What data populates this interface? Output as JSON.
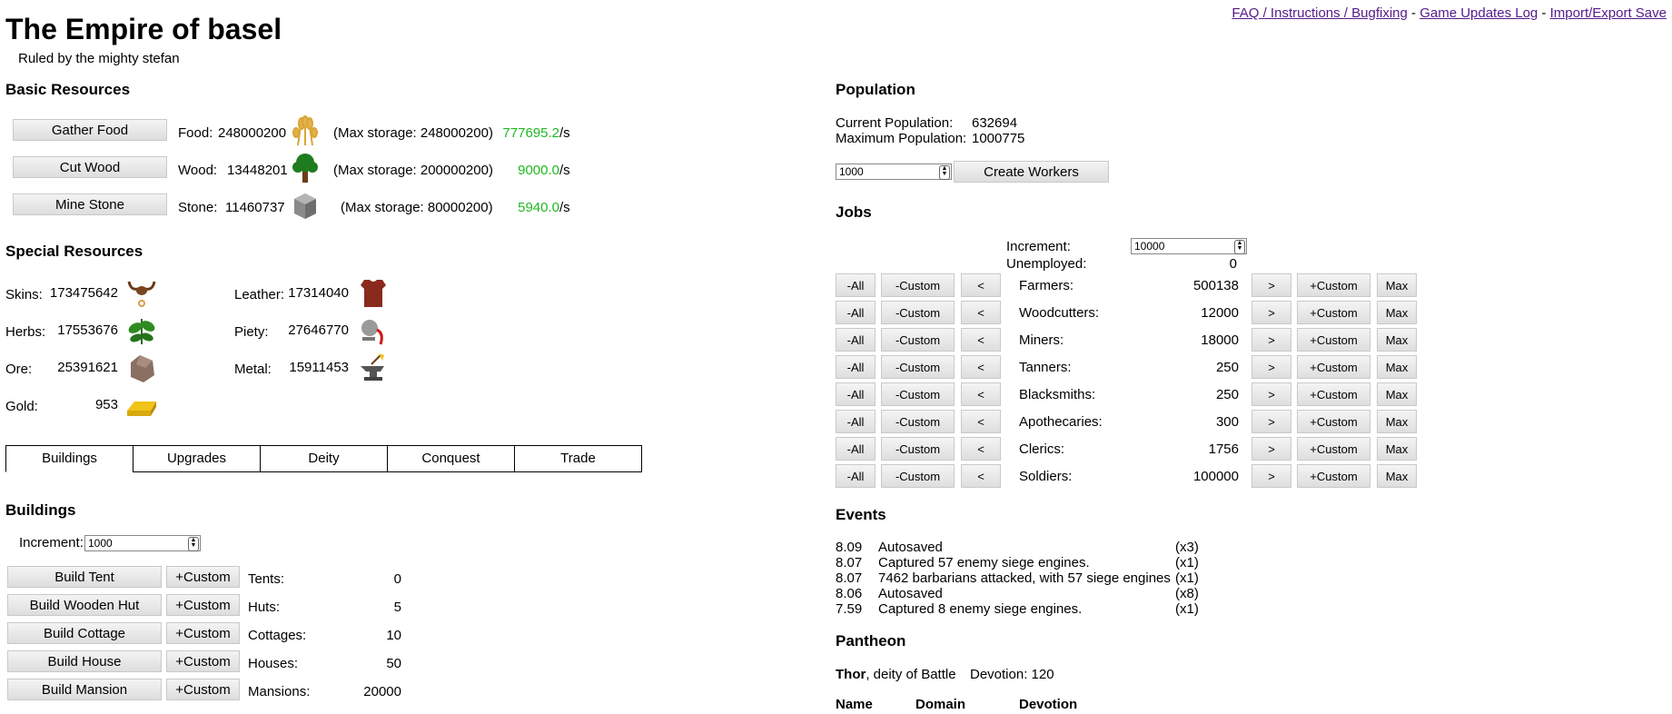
{
  "header": {
    "title": "The Empire of basel",
    "subtitle": "Ruled by the mighty stefan",
    "links": [
      "FAQ / Instructions / Bugfixing",
      "Game Updates Log",
      "Import/Export Save"
    ],
    "separator": " - "
  },
  "basic": {
    "heading": "Basic Resources",
    "rows": [
      {
        "button": "Gather Food",
        "label": "Food:",
        "amount": "248000200",
        "storage": "(Max storage: 248000200)",
        "rate": "777695.2",
        "unit": "/s",
        "icon": "wheat-icon"
      },
      {
        "button": "Cut Wood",
        "label": "Wood:",
        "amount": "13448201",
        "storage": "(Max storage: 200000200)",
        "rate": "9000.0",
        "unit": "/s",
        "icon": "tree-icon"
      },
      {
        "button": "Mine Stone",
        "label": "Stone:",
        "amount": "11460737",
        "storage": "(Max storage: 80000200)",
        "rate": "5940.0",
        "unit": "/s",
        "icon": "stone-icon"
      }
    ]
  },
  "special": {
    "heading": "Special Resources",
    "left": [
      {
        "label": "Skins:",
        "amount": "173475642",
        "icon": "skull-horns-icon"
      },
      {
        "label": "Herbs:",
        "amount": "17553676",
        "icon": "herb-icon"
      },
      {
        "label": "Ore:",
        "amount": "25391621",
        "icon": "ore-icon"
      },
      {
        "label": "Gold:",
        "amount": "953",
        "icon": "gold-bar-icon"
      }
    ],
    "right": [
      {
        "label": "Leather:",
        "amount": "17314040",
        "icon": "leather-armor-icon"
      },
      {
        "label": "Piety:",
        "amount": "27646770",
        "icon": "piety-icon"
      },
      {
        "label": "Metal:",
        "amount": "15911453",
        "icon": "anvil-icon"
      }
    ]
  },
  "tabs": [
    "Buildings",
    "Upgrades",
    "Deity",
    "Conquest",
    "Trade"
  ],
  "buildings": {
    "heading": "Buildings",
    "increment_label": "Increment:",
    "increment_value": "1000",
    "custom_label": "+Custom",
    "rows": [
      {
        "button": "Build Tent",
        "label": "Tents:",
        "count": "0"
      },
      {
        "button": "Build Wooden Hut",
        "label": "Huts:",
        "count": "5"
      },
      {
        "button": "Build Cottage",
        "label": "Cottages:",
        "count": "10"
      },
      {
        "button": "Build House",
        "label": "Houses:",
        "count": "50"
      },
      {
        "button": "Build Mansion",
        "label": "Mansions:",
        "count": "20000"
      }
    ]
  },
  "population": {
    "heading": "Population",
    "current_label": "Current Population:",
    "current_value": "632694",
    "max_label": "Maximum Population:",
    "max_value": "1000775",
    "input_value": "1000",
    "create_button": "Create Workers"
  },
  "jobs": {
    "heading": "Jobs",
    "increment_label": "Increment:",
    "increment_value": "10000",
    "unemployed_label": "Unemployed:",
    "unemployed_value": "0",
    "btn_all": "-All",
    "btn_minus_custom": "-Custom",
    "btn_less": "<",
    "btn_more": ">",
    "btn_plus_custom": "+Custom",
    "btn_max": "Max",
    "rows": [
      {
        "label": "Farmers:",
        "count": "500138"
      },
      {
        "label": "Woodcutters:",
        "count": "12000"
      },
      {
        "label": "Miners:",
        "count": "18000"
      },
      {
        "label": "Tanners:",
        "count": "250"
      },
      {
        "label": "Blacksmiths:",
        "count": "250"
      },
      {
        "label": "Apothecaries:",
        "count": "300"
      },
      {
        "label": "Clerics:",
        "count": "1756"
      },
      {
        "label": "Soldiers:",
        "count": "100000"
      }
    ]
  },
  "events": {
    "heading": "Events",
    "rows": [
      {
        "time": "8.09",
        "text": "Autosaved",
        "mult": "(x3)"
      },
      {
        "time": "8.07",
        "text": "Captured 57 enemy siege engines.",
        "mult": "(x1)"
      },
      {
        "time": "8.07",
        "text": "7462 barbarians attacked, with 57 siege engines",
        "mult": "(x1)"
      },
      {
        "time": "8.06",
        "text": "Autosaved",
        "mult": "(x8)"
      },
      {
        "time": "7.59",
        "text": "Captured 8 enemy siege engines.",
        "mult": "(x1)"
      }
    ]
  },
  "pantheon": {
    "heading": "Pantheon",
    "deity_name": "Thor",
    "deity_desc": ", deity of Battle",
    "devotion_label": "Devotion: 120",
    "columns": [
      "Name",
      "Domain",
      "Devotion"
    ]
  },
  "colors": {
    "rate_green": "#1fb91f",
    "link_purple": "#551a8b"
  }
}
